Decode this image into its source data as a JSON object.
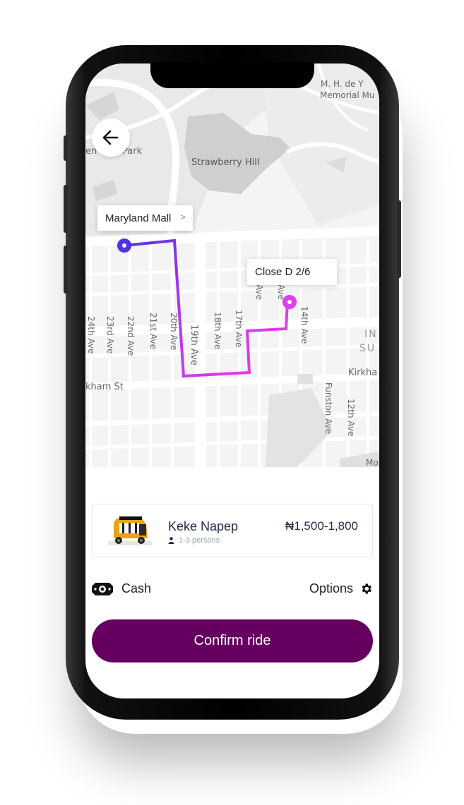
{
  "map": {
    "pickup_label": "Maryland Mall",
    "dropoff_label": "Close D 2/6",
    "place_labels": [
      "Strawberry Hill",
      "Park",
      "M. H. de Y",
      "Memorial Mu",
      "kham St",
      "Kirkha",
      "IN",
      "SU",
      "Funston Ave",
      "12th Ave",
      "Mor"
    ],
    "street_labels": [
      "24th Ave",
      "23rd Ave",
      "22nd Ave",
      "21st Ave",
      "20th Ave",
      "19th Ave",
      "18th Ave",
      "17th Ave",
      "Ave",
      "Ave",
      "14th Ave"
    ],
    "route_start_color": "#4f33e6",
    "route_end_color": "#e03ee8"
  },
  "ride": {
    "name": "Keke Napep",
    "capacity": "1-3 persons",
    "price": "₦1,500-1,800"
  },
  "payment": {
    "method": "Cash"
  },
  "options": {
    "label": "Options"
  },
  "confirm": {
    "label": "Confirm ride"
  },
  "colors": {
    "primary": "#650061"
  },
  "icons": [
    "back-arrow-icon",
    "chevron-right-icon",
    "person-icon",
    "cash-icon",
    "gear-icon"
  ]
}
